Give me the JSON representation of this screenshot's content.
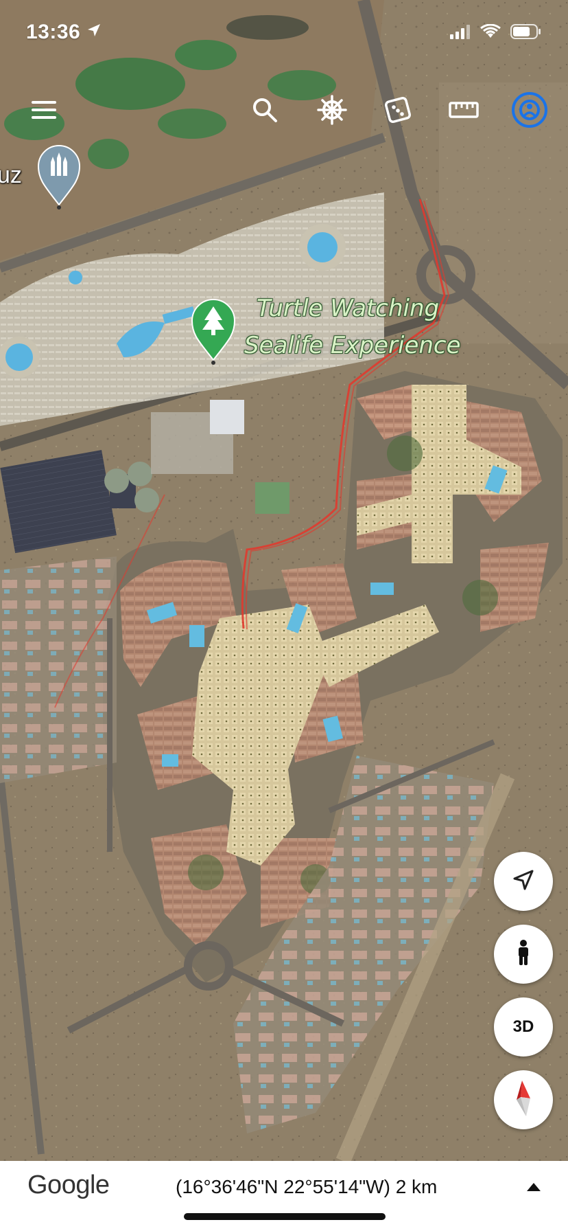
{
  "status_bar": {
    "time": "13:36",
    "location_icon": "location-arrow-icon",
    "signal_icon": "cellular-signal-icon",
    "wifi_icon": "wifi-icon",
    "battery_icon": "battery-icon"
  },
  "toolbar": {
    "menu_icon": "hamburger-menu-icon",
    "search_icon": "search-icon",
    "voyager_icon": "ship-wheel-icon",
    "random_icon": "dice-icon",
    "measure_icon": "ruler-icon",
    "account_icon": "account-icon"
  },
  "map": {
    "partial_place_label": "uz",
    "poi_name_line1": "Turtle Watching",
    "poi_name_line2": "Sealife Experience",
    "poi_icon": "tree-pin-icon",
    "temple_pin_icon": "temple-pin-icon"
  },
  "controls": {
    "my_location_icon": "navigation-arrow-icon",
    "street_view_icon": "pegman-icon",
    "view_3d_label": "3D",
    "compass_icon": "compass-icon"
  },
  "bottom_bar": {
    "logo": "Google",
    "coordinates": "(16°36'46\"N 22°55'14\"W) 2 km",
    "expand_icon": "triangle-up-icon"
  },
  "colors": {
    "route": "#e03a2f",
    "poi_green": "#34a853",
    "compass_red": "#e53935",
    "account_blue": "#1a73e8"
  }
}
